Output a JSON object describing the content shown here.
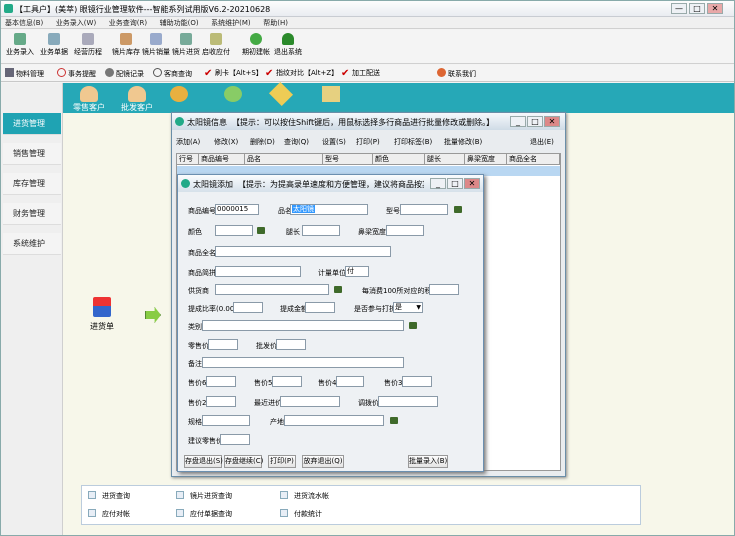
{
  "app": {
    "title": "【工具户】(美萃) 眼镜行业管理软件---智能系列试用版V6.2-20210628",
    "window_controls": [
      "—",
      "□",
      "✕"
    ]
  },
  "menu": [
    "基本信息(B)",
    "业务录入(W)",
    "业务查询(R)",
    "辅助功能(O)",
    "系统维护(M)",
    "帮助(H)"
  ],
  "toolbar1": [
    "业务录入",
    "业务单据",
    "经营历程",
    "镜片库存",
    "镜片销量",
    "镜片进货",
    "启收应付",
    "期初建帐",
    "退出系统"
  ],
  "toolbar2": [
    "物料管理",
    "事务提醒",
    "配镜记录",
    "客商查询",
    "刷卡【Alt+S】",
    "指纹对比【Alt+Z】",
    "加工配送",
    "联系我们"
  ],
  "sidebar": [
    "进货管理",
    "销售管理",
    "库存管理",
    "财务管理",
    "系统维护"
  ],
  "top_icons": [
    "零售客户",
    "批发客户"
  ],
  "flow": {
    "label": "进货单"
  },
  "links": {
    "row1": [
      "进货查询",
      "镜片进货查询",
      "进货流水帐"
    ],
    "row2": [
      "应付对帐",
      "应付单据查询",
      "付款统计"
    ]
  },
  "info_window": {
    "title": "太阳镜信息",
    "hint": "【提示：可以按住Shift键后，用鼠标选择多行商品进行批量修改或删除。】",
    "controls": [
      "_",
      "□",
      "✕"
    ],
    "tools": [
      "添加(A)",
      "修改(X)",
      "删除(D)",
      "查询(Q)",
      "设置(S)",
      "打印(P)",
      "打印标签(B)",
      "批量修改(B)",
      "退出(E)"
    ],
    "columns": [
      "行号",
      "商品编号",
      "品名",
      "型号",
      "颜色",
      "腿长",
      "鼻梁宽度",
      "商品全名"
    ]
  },
  "add_window": {
    "title": "太阳镜添加",
    "hint": "【提示：为提高录单速度和方便管理，建议将商品按其所属的品牌进...",
    "controls": [
      "_",
      "□",
      "✕"
    ],
    "labels": {
      "code": "商品编号",
      "name": "品名",
      "model": "型号",
      "color": "颜色",
      "leg": "腿长",
      "bridge": "鼻梁宽度",
      "fullname": "商品全名",
      "short": "商品简拼",
      "unit": "计量单位",
      "supplier": "供货商",
      "points": "每消费100所对应的积分",
      "ratio": "提成比率(0.00)",
      "amount": "提成金额",
      "discount": "是否参与打折",
      "category": "类别",
      "retail": "零售价",
      "wholesale": "批发价",
      "note": "备注",
      "p6": "售价6",
      "p5": "售价5",
      "p4": "售价4",
      "p3": "售价3",
      "p2": "售价2",
      "recent": "最近进价",
      "adjust": "调拨价",
      "spec": "规格",
      "origin": "产地",
      "suggest": "建议零售价"
    },
    "values": {
      "code": "0000015",
      "name": "太阳镜",
      "unit": "付",
      "discount": "是"
    },
    "buttons": [
      "存盘退出(S)",
      "存盘继续(C)",
      "打印(P)",
      "放弃退出(Q)",
      "批量录入(B)"
    ]
  }
}
